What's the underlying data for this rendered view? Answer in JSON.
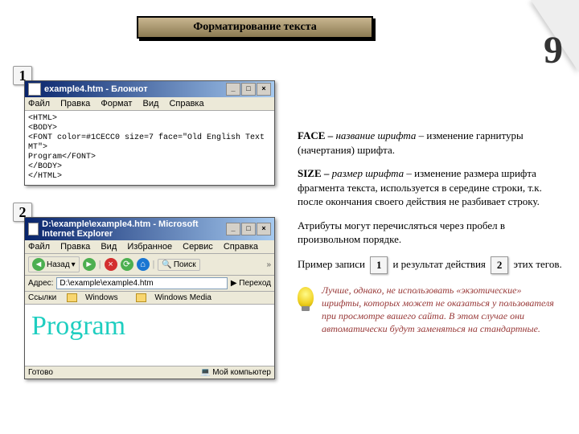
{
  "page": {
    "title": "Форматирование текста",
    "number": "9",
    "badge1": "1",
    "badge2": "2"
  },
  "notepad": {
    "title": "example4.htm - Блокнот",
    "menu": {
      "file": "Файл",
      "edit": "Правка",
      "format": "Формат",
      "view": "Вид",
      "help": "Справка"
    },
    "code": {
      "l1": "<HTML>",
      "l2": "<BODY>",
      "l3": "<FONT color=#1CECC0 size=7 face=\"Old English Text MT\">",
      "l4": "Program</FONT>",
      "l5": "</BODY>",
      "l6": "</HTML>"
    }
  },
  "ie": {
    "title": "D:\\example\\example4.htm - Microsoft Internet Explorer",
    "menu": {
      "file": "Файл",
      "edit": "Правка",
      "view": "Вид",
      "fav": "Избранное",
      "tools": "Сервис",
      "help": "Справка"
    },
    "toolbar": {
      "back": "Назад",
      "search": "Поиск"
    },
    "address_label": "Адрес:",
    "address_value": "D:\\example\\example4.htm",
    "go": "Переход",
    "links_label": "Ссылки",
    "link1": "Windows",
    "link2": "Windows Media",
    "body_text": "Program",
    "status_left": "Готово",
    "status_right": "Мой компьютер"
  },
  "text": {
    "p1a": "FACE – ",
    "p1b": "название шрифта",
    "p1c": " – изменение гарнитуры (начертания) шрифта.",
    "p2a": "SIZE – ",
    "p2b": "размер шрифта",
    "p2c": " – изменение размера шрифта фрагмента текста, используется в середине строки, т.к. после окончания своего действия не разбивает строку.",
    "p3": "Атрибуты могут перечисляться через пробел в произвольном порядке.",
    "p4a": "Пример записи ",
    "p4b": " и результат действия ",
    "p4c": " этих тегов.",
    "b1": "1",
    "b2": "2",
    "tip": "Лучше, однако, не использовать «экзотические» шрифты, которых может не оказаться у пользователя при просмотре вашего сайта. В этом случае они автоматически будут заменяться на стандартные."
  }
}
